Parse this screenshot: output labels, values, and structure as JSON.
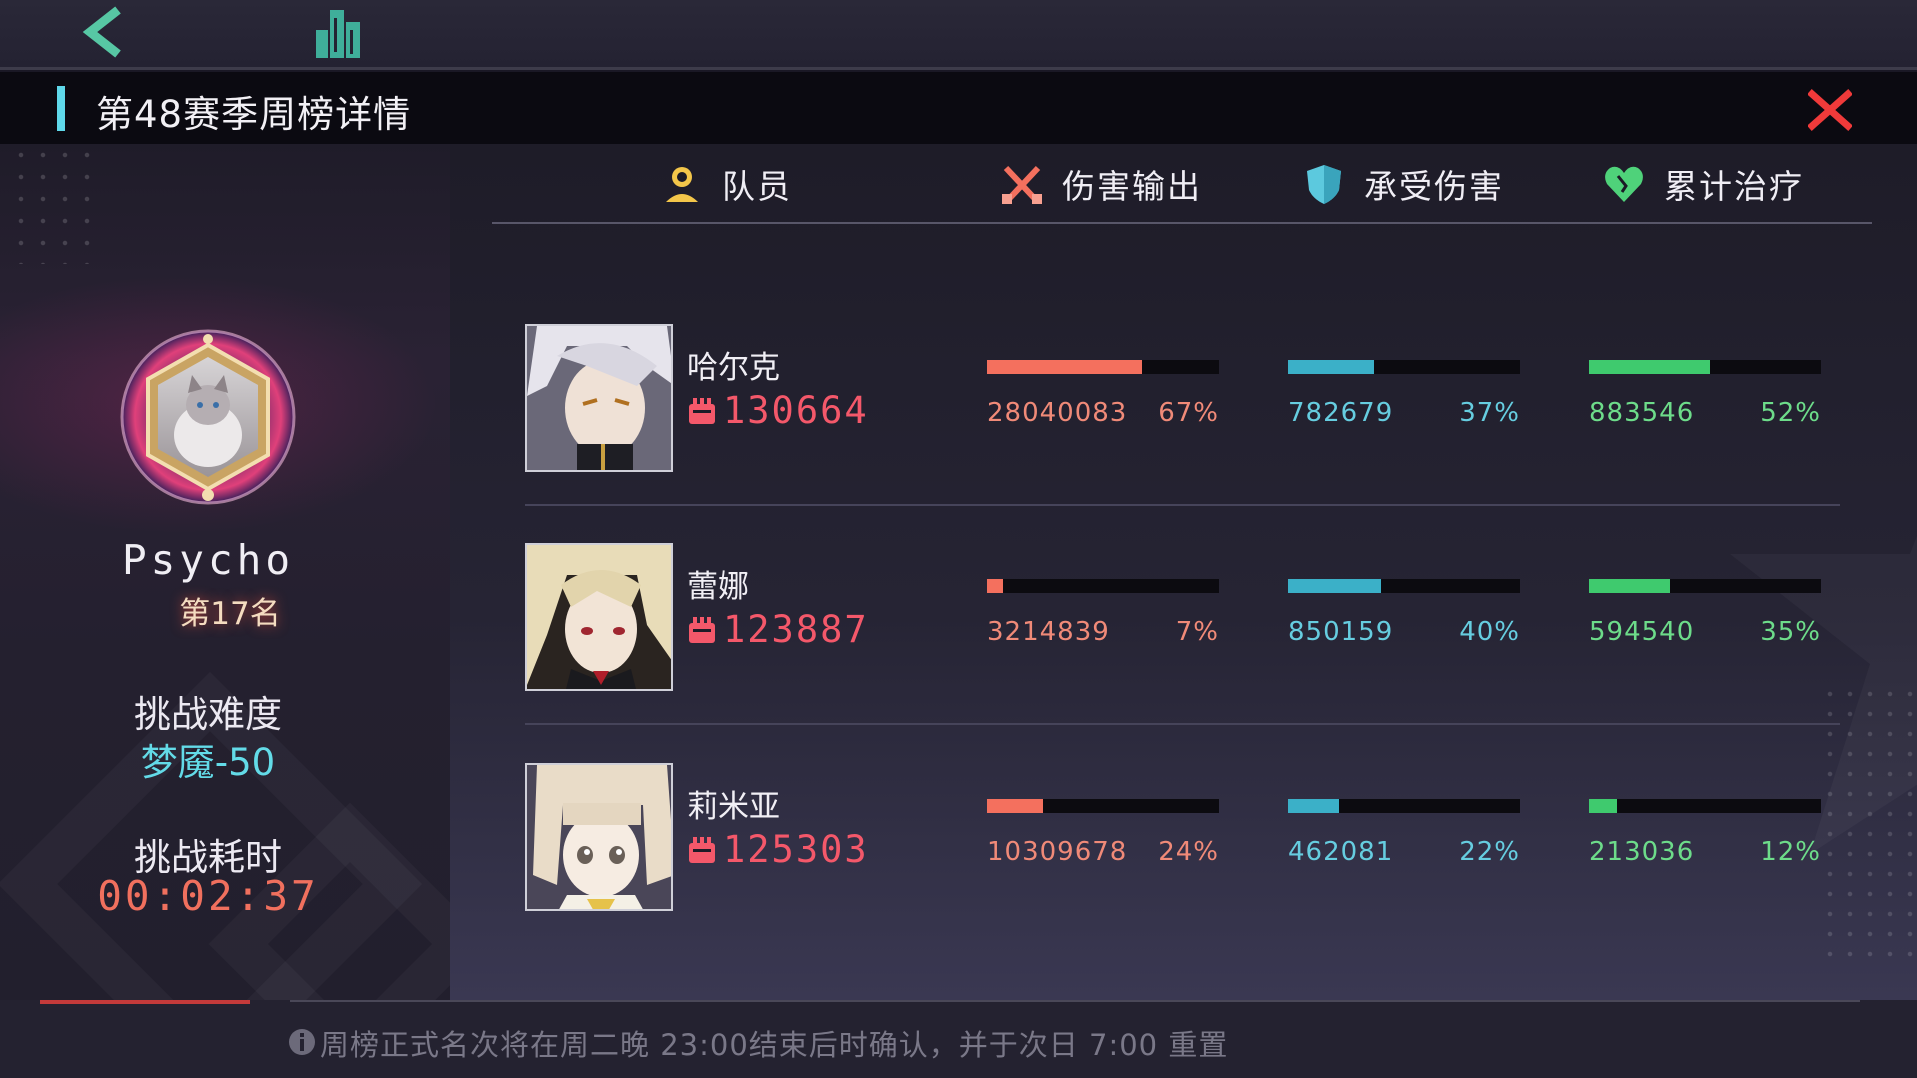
{
  "dialog": {
    "title": "第48赛季周榜详情"
  },
  "player": {
    "name": "Psycho",
    "rank": "第17名",
    "difficulty_label": "挑战难度",
    "difficulty_value": "梦魇-50",
    "time_label": "挑战耗时",
    "time_value": "00:02:37"
  },
  "columns": {
    "member": "队员",
    "damage": "伤害输出",
    "taken": "承受伤害",
    "healing": "累计治疗"
  },
  "colors": {
    "damage": "#f4705e",
    "taken": "#3bb0c8",
    "healing": "#3fca6e",
    "accent": "#5fd8ea",
    "close": "#f03a3a"
  },
  "rows": [
    {
      "name": "哈尔克",
      "power": "130664",
      "damage": {
        "value": "28040083",
        "pct": "67%",
        "ratio": 0.67
      },
      "taken": {
        "value": "782679",
        "pct": "37%",
        "ratio": 0.37
      },
      "healing": {
        "value": "883546",
        "pct": "52%",
        "ratio": 0.52
      }
    },
    {
      "name": "蕾娜",
      "power": "123887",
      "damage": {
        "value": "3214839",
        "pct": "7%",
        "ratio": 0.07
      },
      "taken": {
        "value": "850159",
        "pct": "40%",
        "ratio": 0.4
      },
      "healing": {
        "value": "594540",
        "pct": "35%",
        "ratio": 0.35
      }
    },
    {
      "name": "莉米亚",
      "power": "125303",
      "damage": {
        "value": "10309678",
        "pct": "24%",
        "ratio": 0.24
      },
      "taken": {
        "value": "462081",
        "pct": "22%",
        "ratio": 0.22
      },
      "healing": {
        "value": "213036",
        "pct": "12%",
        "ratio": 0.12
      }
    }
  ],
  "footer": {
    "notice": "周榜正式名次将在周二晚 23:00结束后时确认，并于次日 7:00 重置"
  },
  "icons": {
    "back": "back-chevron-icon",
    "city": "city-buildings-icon",
    "close": "close-x-icon",
    "member": "person-icon",
    "damage": "crossed-swords-icon",
    "taken": "shield-icon",
    "healing": "heart-icon",
    "power": "fist-icon",
    "info": "info-icon"
  }
}
